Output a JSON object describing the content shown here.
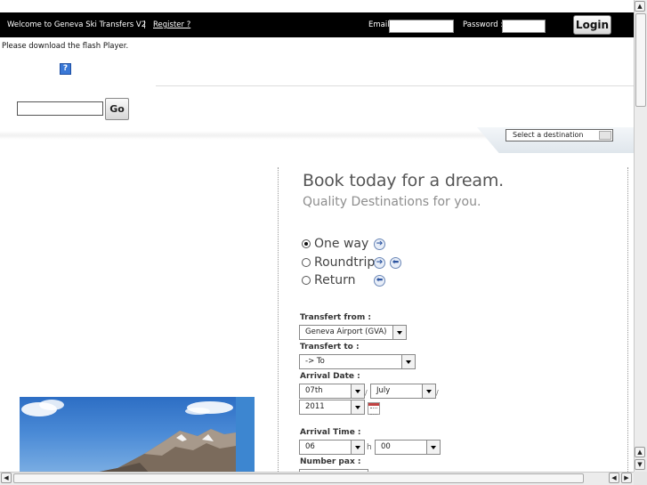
{
  "topbar": {
    "welcome": "Welcome to Geneva Ski Transfers V2",
    "separator": "|",
    "register": "Register ?",
    "email_label": "Email:",
    "password_label": "Password :",
    "login": "Login"
  },
  "flash": {
    "message": "Please download the flash Player.",
    "plugin_icon_glyph": "?"
  },
  "search": {
    "value": "",
    "go": "Go"
  },
  "destination": {
    "selected": "Select a destination"
  },
  "booking": {
    "headline": "Book today for a dream.",
    "subline": "Quality Destinations for you.",
    "trip_types": [
      "One way",
      "Roundtrip",
      "Return"
    ],
    "selected_trip": "One way",
    "from_label": "Transfert from :",
    "from_value": "Geneva Airport (GVA)",
    "to_label": "Transfert to :",
    "to_value": "-> To",
    "arrival_date_label": "Arrival Date :",
    "day": "07th",
    "month": "July",
    "year": "2011",
    "date_sep": "/",
    "arrival_time_label": "Arrival Time :",
    "hour": "06",
    "hour_sep": "h",
    "minute": "00",
    "pax_label": "Number pax :"
  },
  "colors": {
    "topbar_bg": "#000000",
    "arrow_icon": "#2d55a0",
    "photo_sky": "#2d6ec4"
  }
}
